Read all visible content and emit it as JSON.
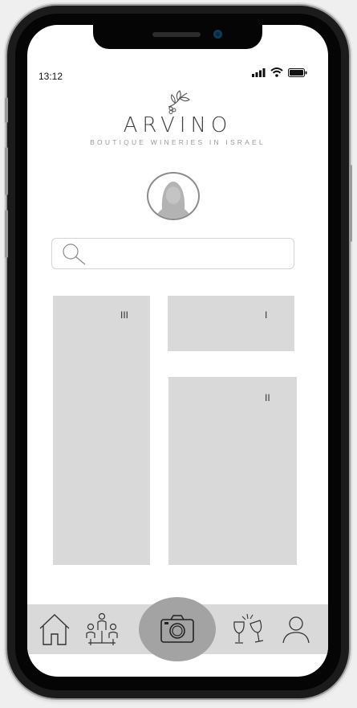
{
  "status_bar": {
    "time": "13:12"
  },
  "logo": {
    "title": "ARVINO",
    "subtitle": "BOUTIQUE WINERIES IN ISRAEL"
  },
  "search": {
    "placeholder": ""
  },
  "tiles": [
    {
      "label": "III"
    },
    {
      "label": "I"
    },
    {
      "label": "II"
    }
  ],
  "nav": {
    "items": [
      "home-icon",
      "group-icon",
      "camera-icon",
      "wine-glasses-icon",
      "profile-icon"
    ]
  },
  "colors": {
    "tile": "#d9d9d9",
    "nav_bar": "#d9d9d9",
    "camera_button": "#a3a3a3"
  }
}
